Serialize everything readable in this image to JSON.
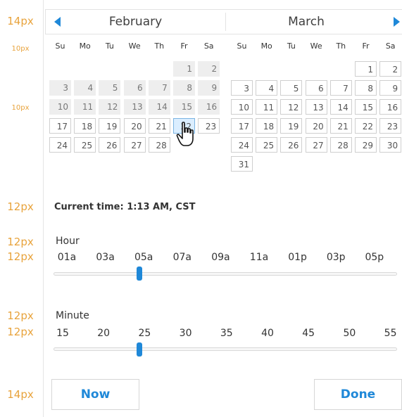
{
  "annotations": [
    "14px",
    "10px",
    "10px",
    "12px",
    "12px",
    "12px",
    "12px",
    "12px",
    "14px"
  ],
  "calendar": {
    "months": [
      {
        "name": "February",
        "weekdays": [
          "Su",
          "Mo",
          "Tu",
          "We",
          "Th",
          "Fr",
          "Sa"
        ],
        "leading_blanks": 5,
        "days_in_month": 28,
        "disabled_days": [
          1,
          2,
          3,
          4,
          5,
          6,
          7,
          8,
          9,
          10,
          11,
          12,
          13,
          14,
          15,
          16
        ],
        "hover_day": 22
      },
      {
        "name": "March",
        "weekdays": [
          "Su",
          "Mo",
          "Tu",
          "We",
          "Th",
          "Fr",
          "Sa"
        ],
        "leading_blanks": 5,
        "days_in_month": 31,
        "disabled_days": [],
        "hover_day": null
      }
    ],
    "prev_icon": "triangle-left-icon",
    "next_icon": "triangle-right-icon"
  },
  "current_time": "Current time: 1:13 AM, CST",
  "hour": {
    "label": "Hour",
    "ticks": [
      "01a",
      "03a",
      "05a",
      "07a",
      "09a",
      "11a",
      "01p",
      "03p",
      "05p"
    ],
    "value_fraction": 0.25
  },
  "minute": {
    "label": "Minute",
    "ticks": [
      "15",
      "20",
      "25",
      "30",
      "35",
      "40",
      "45",
      "50",
      "55"
    ],
    "value_fraction": 0.25
  },
  "buttons": {
    "now": "Now",
    "done": "Done"
  },
  "colors": {
    "accent": "#1f88d8",
    "annotation": "#e8a33c",
    "disabled_cell": "#eeeeee",
    "hover_cell": "#dbeeff"
  }
}
